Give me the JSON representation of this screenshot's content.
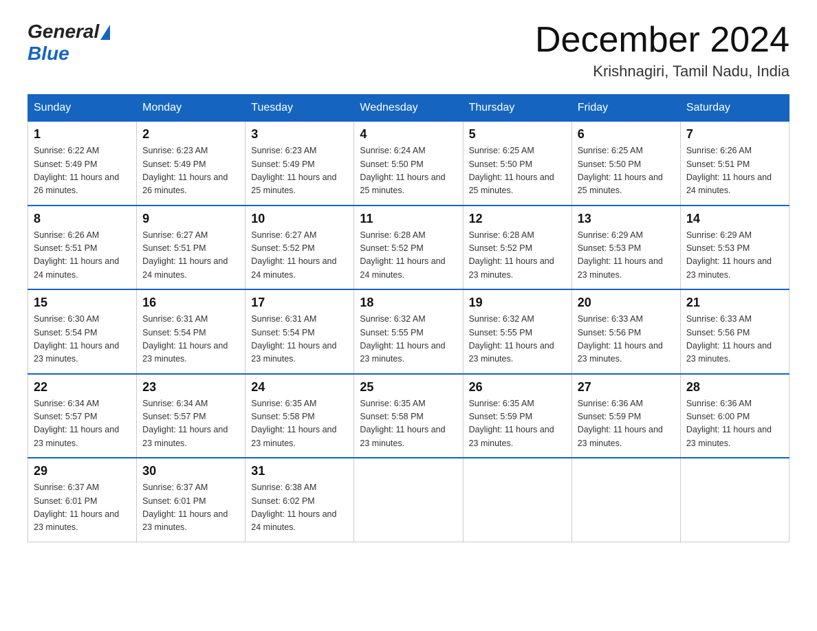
{
  "header": {
    "logo": {
      "general": "General",
      "blue": "Blue"
    },
    "title": "December 2024",
    "location": "Krishnagiri, Tamil Nadu, India"
  },
  "days_of_week": [
    "Sunday",
    "Monday",
    "Tuesday",
    "Wednesday",
    "Thursday",
    "Friday",
    "Saturday"
  ],
  "weeks": [
    [
      {
        "day": "1",
        "sunrise": "6:22 AM",
        "sunset": "5:49 PM",
        "daylight": "11 hours and 26 minutes."
      },
      {
        "day": "2",
        "sunrise": "6:23 AM",
        "sunset": "5:49 PM",
        "daylight": "11 hours and 26 minutes."
      },
      {
        "day": "3",
        "sunrise": "6:23 AM",
        "sunset": "5:49 PM",
        "daylight": "11 hours and 25 minutes."
      },
      {
        "day": "4",
        "sunrise": "6:24 AM",
        "sunset": "5:50 PM",
        "daylight": "11 hours and 25 minutes."
      },
      {
        "day": "5",
        "sunrise": "6:25 AM",
        "sunset": "5:50 PM",
        "daylight": "11 hours and 25 minutes."
      },
      {
        "day": "6",
        "sunrise": "6:25 AM",
        "sunset": "5:50 PM",
        "daylight": "11 hours and 25 minutes."
      },
      {
        "day": "7",
        "sunrise": "6:26 AM",
        "sunset": "5:51 PM",
        "daylight": "11 hours and 24 minutes."
      }
    ],
    [
      {
        "day": "8",
        "sunrise": "6:26 AM",
        "sunset": "5:51 PM",
        "daylight": "11 hours and 24 minutes."
      },
      {
        "day": "9",
        "sunrise": "6:27 AM",
        "sunset": "5:51 PM",
        "daylight": "11 hours and 24 minutes."
      },
      {
        "day": "10",
        "sunrise": "6:27 AM",
        "sunset": "5:52 PM",
        "daylight": "11 hours and 24 minutes."
      },
      {
        "day": "11",
        "sunrise": "6:28 AM",
        "sunset": "5:52 PM",
        "daylight": "11 hours and 24 minutes."
      },
      {
        "day": "12",
        "sunrise": "6:28 AM",
        "sunset": "5:52 PM",
        "daylight": "11 hours and 23 minutes."
      },
      {
        "day": "13",
        "sunrise": "6:29 AM",
        "sunset": "5:53 PM",
        "daylight": "11 hours and 23 minutes."
      },
      {
        "day": "14",
        "sunrise": "6:29 AM",
        "sunset": "5:53 PM",
        "daylight": "11 hours and 23 minutes."
      }
    ],
    [
      {
        "day": "15",
        "sunrise": "6:30 AM",
        "sunset": "5:54 PM",
        "daylight": "11 hours and 23 minutes."
      },
      {
        "day": "16",
        "sunrise": "6:31 AM",
        "sunset": "5:54 PM",
        "daylight": "11 hours and 23 minutes."
      },
      {
        "day": "17",
        "sunrise": "6:31 AM",
        "sunset": "5:54 PM",
        "daylight": "11 hours and 23 minutes."
      },
      {
        "day": "18",
        "sunrise": "6:32 AM",
        "sunset": "5:55 PM",
        "daylight": "11 hours and 23 minutes."
      },
      {
        "day": "19",
        "sunrise": "6:32 AM",
        "sunset": "5:55 PM",
        "daylight": "11 hours and 23 minutes."
      },
      {
        "day": "20",
        "sunrise": "6:33 AM",
        "sunset": "5:56 PM",
        "daylight": "11 hours and 23 minutes."
      },
      {
        "day": "21",
        "sunrise": "6:33 AM",
        "sunset": "5:56 PM",
        "daylight": "11 hours and 23 minutes."
      }
    ],
    [
      {
        "day": "22",
        "sunrise": "6:34 AM",
        "sunset": "5:57 PM",
        "daylight": "11 hours and 23 minutes."
      },
      {
        "day": "23",
        "sunrise": "6:34 AM",
        "sunset": "5:57 PM",
        "daylight": "11 hours and 23 minutes."
      },
      {
        "day": "24",
        "sunrise": "6:35 AM",
        "sunset": "5:58 PM",
        "daylight": "11 hours and 23 minutes."
      },
      {
        "day": "25",
        "sunrise": "6:35 AM",
        "sunset": "5:58 PM",
        "daylight": "11 hours and 23 minutes."
      },
      {
        "day": "26",
        "sunrise": "6:35 AM",
        "sunset": "5:59 PM",
        "daylight": "11 hours and 23 minutes."
      },
      {
        "day": "27",
        "sunrise": "6:36 AM",
        "sunset": "5:59 PM",
        "daylight": "11 hours and 23 minutes."
      },
      {
        "day": "28",
        "sunrise": "6:36 AM",
        "sunset": "6:00 PM",
        "daylight": "11 hours and 23 minutes."
      }
    ],
    [
      {
        "day": "29",
        "sunrise": "6:37 AM",
        "sunset": "6:01 PM",
        "daylight": "11 hours and 23 minutes."
      },
      {
        "day": "30",
        "sunrise": "6:37 AM",
        "sunset": "6:01 PM",
        "daylight": "11 hours and 23 minutes."
      },
      {
        "day": "31",
        "sunrise": "6:38 AM",
        "sunset": "6:02 PM",
        "daylight": "11 hours and 24 minutes."
      },
      null,
      null,
      null,
      null
    ]
  ],
  "labels": {
    "sunrise_prefix": "Sunrise: ",
    "sunset_prefix": "Sunset: ",
    "daylight_prefix": "Daylight: "
  }
}
